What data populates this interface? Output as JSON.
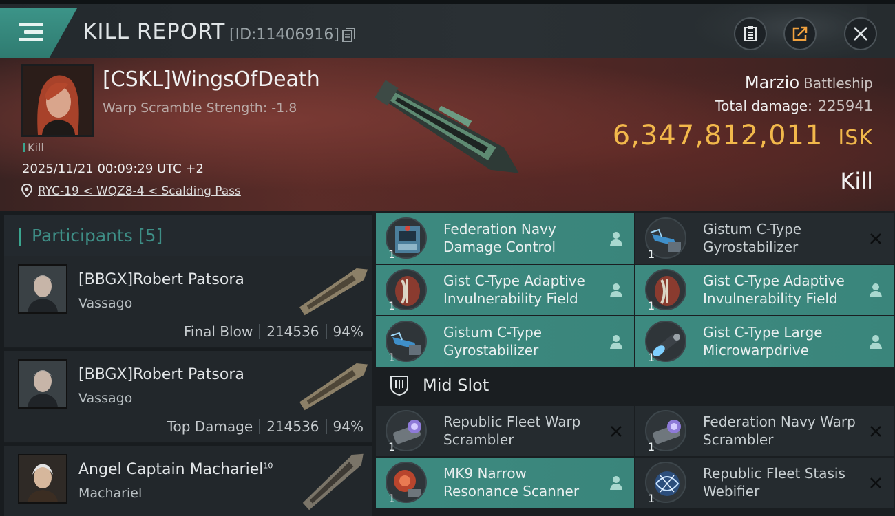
{
  "header": {
    "title": "KILL REPORT",
    "report_id": "[ID:11406916]"
  },
  "victim": {
    "name": "[CSKL]WingsOfDeath",
    "warp_scramble": "Warp Scramble Strength: -1.8",
    "kill_tag": "Kill",
    "time": "2025/11/21 00:09:29 UTC +2",
    "location": "RYC-19 < WQZ8-4 < Scalding Pass",
    "ship_name": "Marzio",
    "ship_class": "Battleship",
    "total_damage_label": "Total damage:",
    "total_damage": "225941",
    "isk_value": "6,347,812,011",
    "isk_unit": "ISK",
    "result": "Kill"
  },
  "participants": {
    "label": "Participants",
    "count": "[5]",
    "items": [
      {
        "name": "[BBGX]Robert Patsora",
        "ship": "Vassago",
        "tag": "Final Blow",
        "damage": "214536",
        "percent": "94%"
      },
      {
        "name": "[BBGX]Robert Patsora",
        "ship": "Vassago",
        "tag": "Top Damage",
        "damage": "214536",
        "percent": "94%"
      },
      {
        "name": "Angel Captain Machariel",
        "level": "10",
        "ship": "Machariel"
      }
    ]
  },
  "modules": {
    "low": [
      {
        "name": "Federation Navy Damage Control",
        "qty": "1",
        "state": "fitted"
      },
      {
        "name": "Gistum C-Type Gyrostabilizer",
        "qty": "1",
        "state": "destroyed"
      },
      {
        "name": "Gist C-Type Adaptive Invulnerability Field",
        "qty": "1",
        "state": "fitted"
      },
      {
        "name": "Gist C-Type Adaptive Invulnerability Field",
        "qty": "1",
        "state": "fitted"
      },
      {
        "name": "Gistum C-Type Gyrostabilizer",
        "qty": "1",
        "state": "fitted"
      },
      {
        "name": "Gist C-Type Large Microwarpdrive",
        "qty": "1",
        "state": "fitted"
      }
    ],
    "mid_label": "Mid Slot",
    "mid": [
      {
        "name": "Republic Fleet Warp Scrambler",
        "qty": "1",
        "state": "destroyed"
      },
      {
        "name": "Federation Navy Warp Scrambler",
        "qty": "1",
        "state": "destroyed"
      },
      {
        "name": "MK9 Narrow Resonance Scanner",
        "qty": "1",
        "state": "fitted"
      },
      {
        "name": "Republic Fleet Stasis Webifier",
        "qty": "1",
        "state": "destroyed"
      }
    ]
  },
  "colors": {
    "accent": "#3aa58f",
    "isk": "#f2b84b",
    "fitted": "#3d8a80",
    "destroyed": "#252b2f"
  }
}
